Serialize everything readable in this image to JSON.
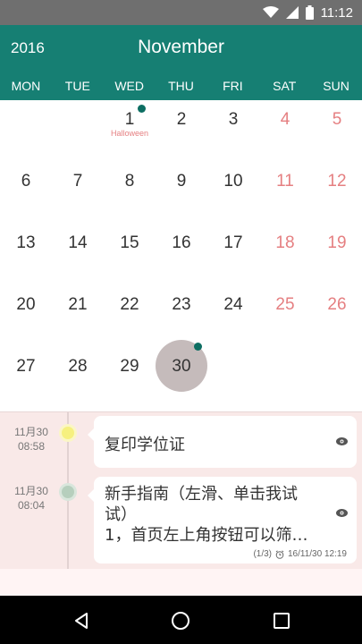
{
  "status_bar": {
    "time": "11:12",
    "icons": [
      "wifi-icon",
      "signal-icon",
      "battery-icon"
    ]
  },
  "header": {
    "year": "2016",
    "month": "November",
    "weekdays": [
      "MON",
      "TUE",
      "WED",
      "THU",
      "FRI",
      "SAT",
      "SUN"
    ],
    "color": "#167f73"
  },
  "calendar": {
    "weeks": [
      [
        "",
        "",
        "1",
        "2",
        "3",
        "4",
        "5"
      ],
      [
        "6",
        "7",
        "8",
        "9",
        "10",
        "11",
        "12"
      ],
      [
        "13",
        "14",
        "15",
        "16",
        "17",
        "18",
        "19"
      ],
      [
        "20",
        "21",
        "22",
        "23",
        "24",
        "25",
        "26"
      ],
      [
        "27",
        "28",
        "29",
        "30",
        "",
        "",
        ""
      ]
    ],
    "holiday_label": "Halloween",
    "selected_day": "30",
    "weekend_color": "#e57f81"
  },
  "events": [
    {
      "date": "11月30",
      "time": "08:58",
      "title": "复印学位证",
      "dot_color": "#f6f07f"
    },
    {
      "date": "11月30",
      "time": "08:04",
      "title_line1": "新手指南（左滑、单击我试",
      "title_line2": "试）",
      "title_line3": "1，首页左上角按钮可以筛…",
      "counter": "(1/3)",
      "reminder": "16/11/30 12:19",
      "dot_color": "#b6cfbd"
    }
  ],
  "nav": {
    "icons": [
      "back-icon",
      "home-icon",
      "recents-icon"
    ]
  }
}
